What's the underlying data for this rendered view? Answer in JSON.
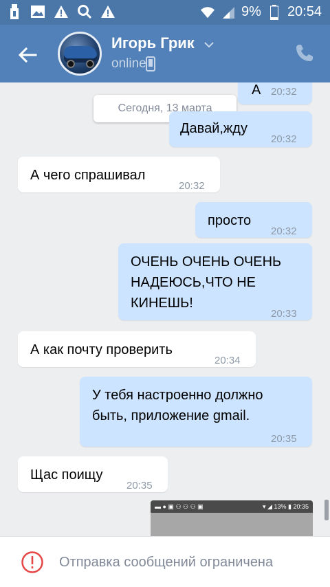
{
  "status_bar": {
    "battery": "9%",
    "time": "20:54",
    "icons": [
      "usb-icon",
      "image-icon",
      "warning-icon",
      "search-icon",
      "warning-icon",
      "wifi-icon",
      "signal-icon",
      "battery-icon"
    ]
  },
  "header": {
    "name": "Игорь Грик",
    "status": "online"
  },
  "date_separator": "Сегодня, 13 марта",
  "messages": [
    {
      "dir": "out",
      "text": "А",
      "time": "20:32"
    },
    {
      "dir": "out",
      "text": "Давай,жду",
      "time": "20:32"
    },
    {
      "dir": "in",
      "text": "А чего спрашивал",
      "time": "20:32"
    },
    {
      "dir": "out",
      "text": "просто",
      "time": "20:32"
    },
    {
      "dir": "out",
      "text": "ОЧЕНЬ ОЧЕНЬ ОЧЕНЬ НАДЕЮСЬ,ЧТО НЕ КИНЕШЬ!",
      "lines": [
        "ОЧЕНЬ ОЧЕНЬ ОЧЕНЬ",
        "НАДЕЮСЬ,ЧТО НЕ",
        "КИНЕШЬ!"
      ],
      "time": "20:33"
    },
    {
      "dir": "in",
      "text": "А как почту проверить",
      "time": "20:34"
    },
    {
      "dir": "out",
      "text": "У тебя настроенно должно быть, приложение gmail.",
      "lines": [
        "У тебя настроенно должно",
        "быть, приложение gmail."
      ],
      "time": "20:35"
    },
    {
      "dir": "in",
      "text": "Щас поищу",
      "time": "20:35"
    }
  ],
  "preview": {
    "battery": "13%",
    "time": "20:35"
  },
  "footer": {
    "text": "Отправка сообщений ограничена"
  },
  "colors": {
    "header": "#5181b8",
    "status_bar": "#4a76a8",
    "outgoing_bubble": "#cce4ff",
    "incoming_bubble": "#ffffff",
    "background": "#edeef0",
    "warning": "#e64646"
  }
}
